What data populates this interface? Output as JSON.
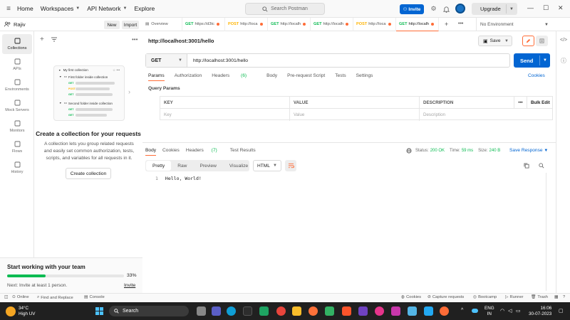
{
  "topbar": {
    "home": "Home",
    "workspaces": "Workspaces",
    "api_network": "API Network",
    "explore": "Explore",
    "search_placeholder": "Search Postman",
    "invite": "Invite",
    "upgrade": "Upgrade"
  },
  "workspace": {
    "name": "Rajiv",
    "new": "New",
    "import": "Import"
  },
  "leftnav": [
    {
      "label": "Collections",
      "icon": "collections-icon"
    },
    {
      "label": "APIs",
      "icon": "apis-icon"
    },
    {
      "label": "Environments",
      "icon": "environments-icon"
    },
    {
      "label": "Mock Servers",
      "icon": "mock-servers-icon"
    },
    {
      "label": "Monitors",
      "icon": "monitors-icon"
    },
    {
      "label": "Flows",
      "icon": "flows-icon"
    },
    {
      "label": "History",
      "icon": "history-icon"
    }
  ],
  "illustration": {
    "collection": "My first collection",
    "folder1": "First folder inside collection",
    "folder2": "Second folder inside collection",
    "get": "GET",
    "post": "POST"
  },
  "empty_state": {
    "title": "Create a collection for your requests",
    "description": "A collection lets you group related requests and easily set common authorization, tests, scripts, and variables for all requests in it.",
    "button": "Create collection"
  },
  "onboarding": {
    "title": "Start working with your team",
    "progress_pct": 33,
    "progress_label": "33%",
    "next": "Next: Invite at least 1 person.",
    "invite": "Invite"
  },
  "tabs": [
    {
      "label": "Overview",
      "method": "",
      "dot": false
    },
    {
      "label": "https://d3tc",
      "method": "GET",
      "dot": true,
      "mcolor": "#0cbb52"
    },
    {
      "label": "http://loca",
      "method": "POST",
      "dot": true,
      "mcolor": "#ffb400"
    },
    {
      "label": "http://localh",
      "method": "GET",
      "dot": true,
      "mcolor": "#0cbb52"
    },
    {
      "label": "http://localh",
      "method": "GET",
      "dot": true,
      "mcolor": "#0cbb52"
    },
    {
      "label": "http://loca",
      "method": "POST",
      "dot": true,
      "mcolor": "#ffb400"
    },
    {
      "label": "http://localh",
      "method": "GET",
      "dot": true,
      "mcolor": "#0cbb52",
      "active": true
    }
  ],
  "environment": "No Environment",
  "request": {
    "name": "http://localhost:3001/hello",
    "save": "Save",
    "method": "GET",
    "url": "http://localhost:3001/hello",
    "send": "Send"
  },
  "request_tabs": {
    "params": "Params",
    "authorization": "Authorization",
    "headers": "Headers",
    "headers_count": "(6)",
    "body": "Body",
    "prerequest": "Pre-request Script",
    "tests": "Tests",
    "settings": "Settings",
    "cookies": "Cookies"
  },
  "query_params": {
    "title": "Query Params",
    "key": "KEY",
    "value": "VALUE",
    "description": "DESCRIPTION",
    "bulk_edit": "Bulk Edit",
    "key_ph": "Key",
    "value_ph": "Value",
    "description_ph": "Description"
  },
  "response": {
    "tabs": {
      "body": "Body",
      "cookies": "Cookies",
      "headers": "Headers",
      "headers_count": "(7)",
      "test_results": "Test Results"
    },
    "status_label": "Status:",
    "status": "200 OK",
    "time_label": "Time:",
    "time": "59 ms",
    "size_label": "Size:",
    "size": "240 B",
    "save_response": "Save Response",
    "views": [
      "Pretty",
      "Raw",
      "Preview",
      "Visualize"
    ],
    "format": "HTML",
    "line_no": "1",
    "body_text": "Hello, World!"
  },
  "statusbar": {
    "online": "Online",
    "find_replace": "Find and Replace",
    "console": "Console",
    "cookies": "Cookies",
    "capture": "Capture requests",
    "bootcamp": "Bootcamp",
    "runner": "Runner",
    "trash": "Trash"
  },
  "taskbar": {
    "temp": "34°C",
    "weather": "High UV",
    "search": "Search",
    "lang1": "ENG",
    "lang2": "IN",
    "time": "16:06",
    "date": "30-07-2023"
  },
  "colors": {
    "accent": "#ff6c37",
    "primary": "#0265d2",
    "success": "#0cbb52"
  }
}
